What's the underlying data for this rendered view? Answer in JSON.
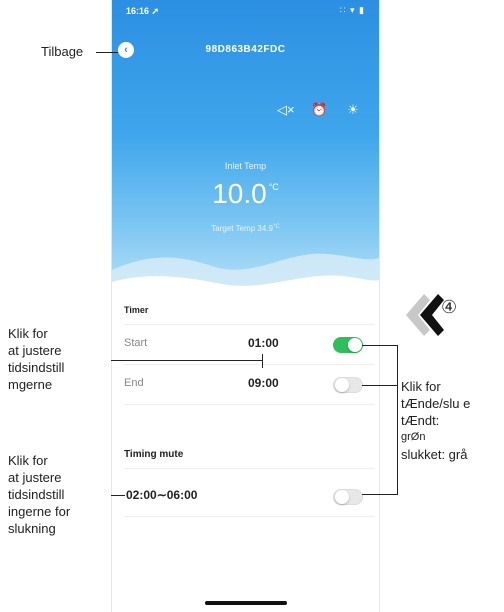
{
  "statusbar": {
    "time": "16:16 ➚",
    "icons": "∷ ▾ ▮"
  },
  "header": {
    "back_glyph": "‹",
    "device_id": "98D863B42FDC"
  },
  "hero_icons": {
    "mute": "◁×",
    "alarm": "⏰",
    "brightness": "☀"
  },
  "inlet": {
    "label": "Inlet Temp",
    "value": "10.0",
    "unit": "°C"
  },
  "target": {
    "label": "Target Temp",
    "value": "34.9",
    "unit": "°C"
  },
  "timer": {
    "title": "Timer",
    "start_label": "Start",
    "start_time": "01:00",
    "start_on": true,
    "end_label": "End",
    "end_time": "09:00",
    "end_on": false
  },
  "timing_mute": {
    "title": "Timing mute",
    "range": "02:00∼06:00",
    "on": false
  },
  "annotations": {
    "back": "Tilbage",
    "adjust_timer": [
      "Klik for",
      "at justere",
      "tidsindstill",
      "mgerne"
    ],
    "adjust_mute": [
      "Klik for",
      "at justere",
      "tidsindstill",
      "ingerne for",
      "slukning"
    ],
    "toggle_help": [
      "Klik for",
      "tÆnde/slu e",
      "tÆndt:",
      "grØn",
      "slukket: grå"
    ],
    "step_number": "④"
  },
  "colors": {
    "accent": "#2c8fe2",
    "toggle_on": "#2fbf5a",
    "toggle_off": "#e8e8e8"
  }
}
